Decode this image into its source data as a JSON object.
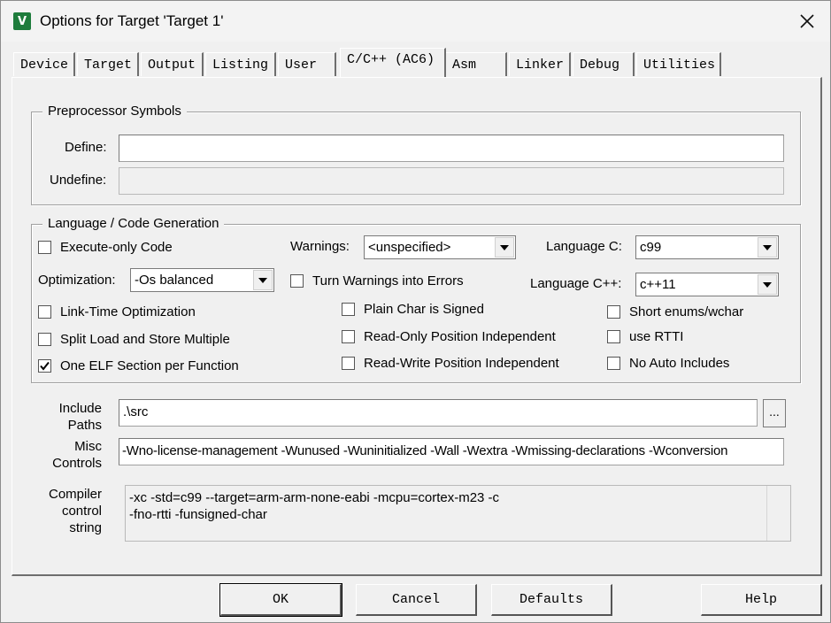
{
  "window": {
    "title": "Options for Target 'Target 1'",
    "app_icon_glyph": "V"
  },
  "tabs": [
    {
      "label": "Device"
    },
    {
      "label": "Target"
    },
    {
      "label": "Output"
    },
    {
      "label": "Listing"
    },
    {
      "label": "User"
    },
    {
      "label": "C/C++ (AC6)",
      "active": true
    },
    {
      "label": "Asm"
    },
    {
      "label": "Linker"
    },
    {
      "label": "Debug"
    },
    {
      "label": "Utilities"
    }
  ],
  "preprocessor": {
    "title": "Preprocessor Symbols",
    "define_label": "Define:",
    "define_value": "",
    "undefine_label": "Undefine:",
    "undefine_value": ""
  },
  "language": {
    "title": "Language / Code Generation",
    "execute_only": {
      "label": "Execute-only Code",
      "checked": false
    },
    "warnings_label": "Warnings:",
    "warnings_value": "<unspecified>",
    "language_c_label": "Language C:",
    "language_c_value": "c99",
    "optimization_label": "Optimization:",
    "optimization_value": "-Os balanced",
    "turn_warnings": {
      "label": "Turn Warnings into Errors",
      "checked": false
    },
    "language_cpp_label": "Language C++:",
    "language_cpp_value": "c++11",
    "lto": {
      "label": "Link-Time Optimization",
      "checked": false
    },
    "plain_char": {
      "label": "Plain Char is Signed",
      "checked": false
    },
    "short_enums": {
      "label": "Short enums/wchar",
      "checked": false
    },
    "split_load": {
      "label": "Split Load and Store Multiple",
      "checked": false
    },
    "ropi": {
      "label": "Read-Only Position Independent",
      "checked": false
    },
    "rtti": {
      "label": "use RTTI",
      "checked": false
    },
    "one_elf": {
      "label": "One ELF Section per Function",
      "checked": true
    },
    "rwpi": {
      "label": "Read-Write Position Independent",
      "checked": false
    },
    "no_auto_includes": {
      "label": "No Auto Includes",
      "checked": false
    }
  },
  "include_paths": {
    "label_line1": "Include",
    "label_line2": "Paths",
    "value": ".\\src",
    "browse_label": "..."
  },
  "misc_controls": {
    "label_line1": "Misc",
    "label_line2": "Controls",
    "value": "-Wno-license-management -Wunused -Wuninitialized -Wall -Wextra -Wmissing-declarations -Wconversion"
  },
  "compiler_string": {
    "label_line1": "Compiler",
    "label_line2": "control",
    "label_line3": "string",
    "line1": "-xc -std=c99 --target=arm-arm-none-eabi -mcpu=cortex-m23 -c",
    "line2": "-fno-rtti -funsigned-char"
  },
  "buttons": {
    "ok": "OK",
    "cancel": "Cancel",
    "defaults": "Defaults",
    "help": "Help"
  }
}
